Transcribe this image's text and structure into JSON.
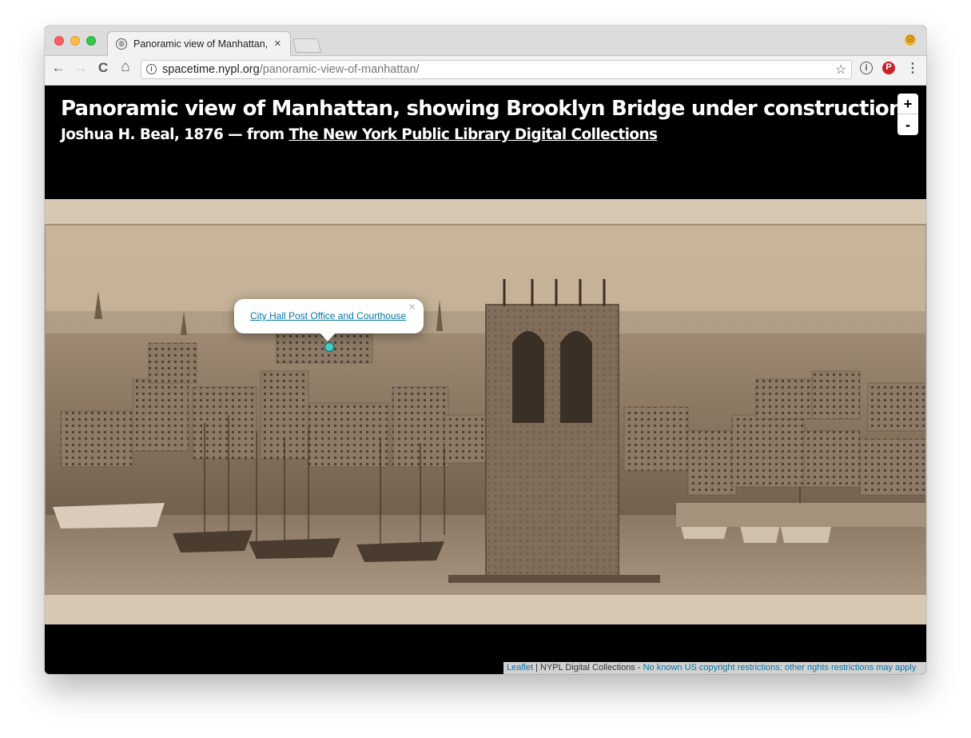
{
  "browser": {
    "tab_title": "Panoramic view of Manhattan, showing Brooklyn Bridge under construction",
    "tab_close": "×",
    "url_domain": "spacetime.nypl.org",
    "url_path": "/panoramic-view-of-manhattan/",
    "nav_icons": {
      "back": "←",
      "forward": "→",
      "reload": "C",
      "home": "⌂"
    },
    "star_glyph": "☆",
    "menu_glyph": "⋮",
    "extension_glyphs": {
      "info": "i",
      "pinterest": "P"
    }
  },
  "page": {
    "title": "Panoramic view of Manhattan, showing Brooklyn Bridge under construction",
    "byline": "Joshua H. Beal, 1876 — from ",
    "collection_link": "The New York Public Library Digital Collections"
  },
  "map": {
    "zoom_in": "+",
    "zoom_out": "-",
    "popup_link": "City Hall Post Office and Courthouse",
    "popup_close": "×",
    "marker_color": "#3fd0cc",
    "attribution": {
      "leaflet": "Leaflet",
      "separator": " | NYPL Digital Collections - ",
      "rights": "No known US copyright restrictions; other rights restrictions may apply"
    }
  },
  "colors": {
    "link": "#0078a8",
    "page_bg": "#000000",
    "photo_sepia": "#b8a48a"
  }
}
